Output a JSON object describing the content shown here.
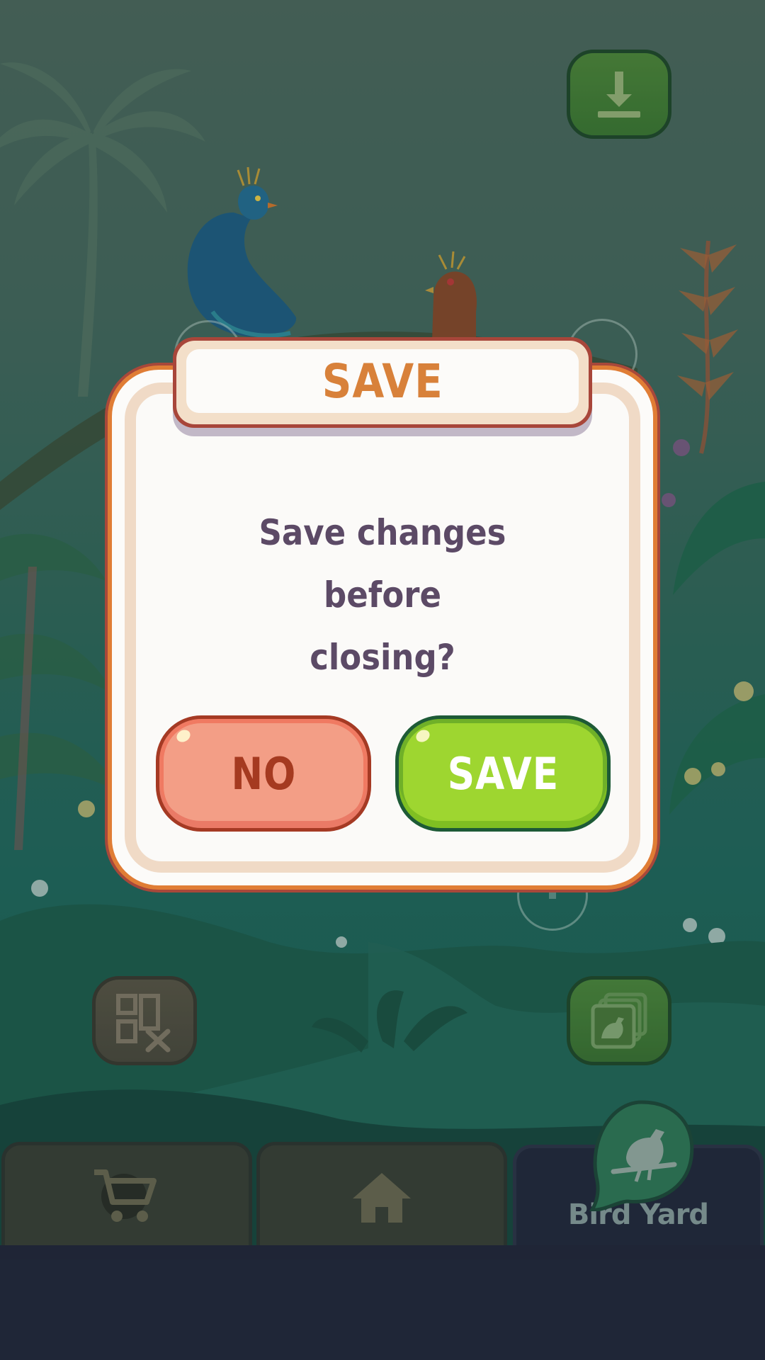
{
  "dialog": {
    "title": "SAVE",
    "message_line1": "Save changes before",
    "message_line2": "closing?",
    "no_label": "NO",
    "save_label": "SAVE"
  },
  "nav": {
    "tabs": [
      {
        "name": "shop",
        "icon": "cart-icon"
      },
      {
        "name": "home",
        "icon": "home-icon"
      },
      {
        "name": "bird-yard",
        "icon": "bird-icon",
        "label": "Bird Yard",
        "selected": true
      }
    ]
  },
  "game_buttons": [
    {
      "name": "download",
      "icon": "download-icon"
    },
    {
      "name": "remove-layout",
      "icon": "grid-remove-icon"
    },
    {
      "name": "gallery",
      "icon": "bird-gallery-icon"
    }
  ],
  "colors": {
    "dialog_border": "#e07d35",
    "title_text": "#d8813a",
    "message_text": "#5c4a66",
    "no_button": "#f39e86",
    "save_button": "#9ed630",
    "nav_bg": "#21253a"
  }
}
